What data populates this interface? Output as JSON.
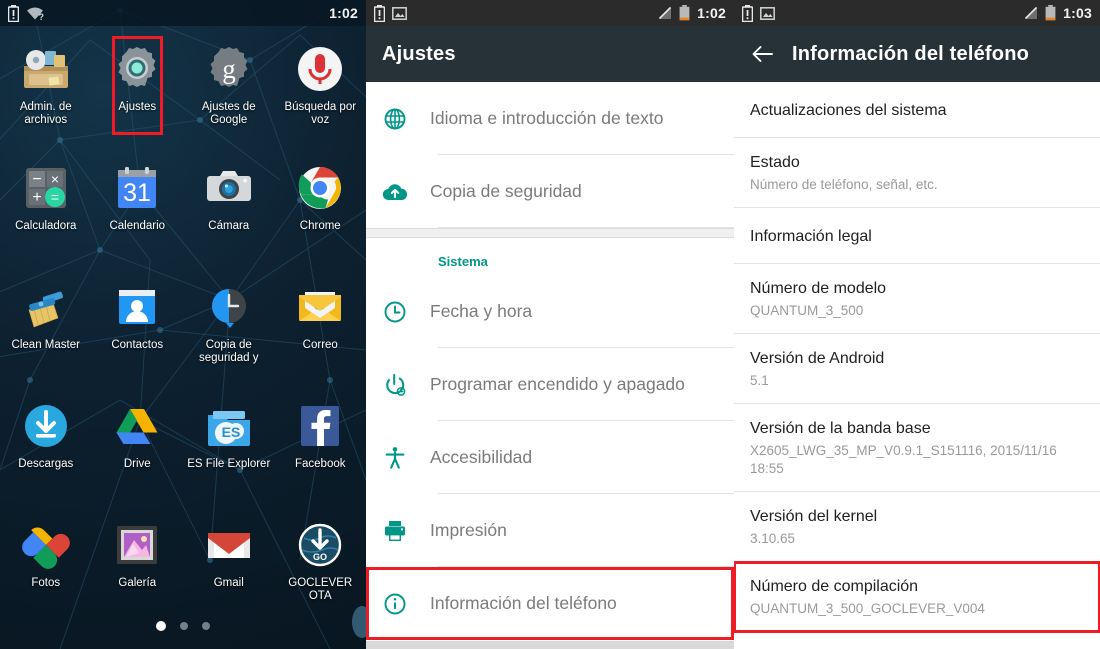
{
  "panels": {
    "home": {
      "statusbar": {
        "time": "1:02",
        "icons_left": [
          "battery-alert-icon",
          "wifi-question-icon"
        ]
      },
      "apps": [
        {
          "label": "Admin. de archivos",
          "icon": "file-manager-icon",
          "highlight": false
        },
        {
          "label": "Ajustes",
          "icon": "settings-gear-icon",
          "highlight": true
        },
        {
          "label": "Ajustes de Google",
          "icon": "google-settings-icon",
          "highlight": false
        },
        {
          "label": "Búsqueda por voz",
          "icon": "voice-search-microphone-icon",
          "highlight": false
        },
        {
          "label": "Calculadora",
          "icon": "calculator-icon",
          "highlight": false
        },
        {
          "label": "Calendario",
          "icon": "calendar-icon",
          "highlight": false
        },
        {
          "label": "Cámara",
          "icon": "camera-icon",
          "highlight": false
        },
        {
          "label": "Chrome",
          "icon": "chrome-icon",
          "highlight": false
        },
        {
          "label": "Clean Master",
          "icon": "clean-master-broom-icon",
          "highlight": false
        },
        {
          "label": "Contactos",
          "icon": "contacts-icon",
          "highlight": false
        },
        {
          "label": "Copia de seguridad y",
          "icon": "backup-clock-icon",
          "highlight": false
        },
        {
          "label": "Correo",
          "icon": "email-icon",
          "highlight": false
        },
        {
          "label": "Descargas",
          "icon": "downloads-icon",
          "highlight": false
        },
        {
          "label": "Drive",
          "icon": "google-drive-icon",
          "highlight": false
        },
        {
          "label": "ES File Explorer",
          "icon": "es-file-explorer-icon",
          "highlight": false
        },
        {
          "label": "Facebook",
          "icon": "facebook-icon",
          "highlight": false
        },
        {
          "label": "Fotos",
          "icon": "google-photos-icon",
          "highlight": false
        },
        {
          "label": "Galería",
          "icon": "gallery-icon",
          "highlight": false
        },
        {
          "label": "Gmail",
          "icon": "gmail-icon",
          "highlight": false
        },
        {
          "label": "GOCLEVER OTA",
          "icon": "goclever-ota-icon",
          "highlight": false
        }
      ],
      "page_dots": {
        "count": 3,
        "active_index": 0
      }
    },
    "settings": {
      "statusbar": {
        "time": "1:02",
        "icons_left": [
          "battery-alert-icon",
          "screenshot-image-icon"
        ]
      },
      "title": "Ajustes",
      "items_top": [
        {
          "label": "Idioma e introducción de texto",
          "icon": "globe-icon"
        },
        {
          "label": "Copia de seguridad",
          "icon": "cloud-upload-icon"
        }
      ],
      "section_label": "Sistema",
      "items_system": [
        {
          "label": "Fecha y hora",
          "icon": "clock-icon",
          "highlight": false
        },
        {
          "label": "Programar encendido y apagado",
          "icon": "power-schedule-icon",
          "highlight": false
        },
        {
          "label": "Accesibilidad",
          "icon": "accessibility-icon",
          "highlight": false
        },
        {
          "label": "Impresión",
          "icon": "printer-icon",
          "highlight": false
        },
        {
          "label": "Información del teléfono",
          "icon": "info-circle-icon",
          "highlight": true
        }
      ]
    },
    "about": {
      "statusbar": {
        "time": "1:03",
        "icons_left": [
          "battery-alert-icon",
          "screenshot-image-icon"
        ]
      },
      "title": "Información del teléfono",
      "back_icon": "back-arrow-icon",
      "items": [
        {
          "title": "Actualizaciones del sistema",
          "sub": "",
          "highlight": false
        },
        {
          "title": "Estado",
          "sub": "Número de teléfono, señal, etc.",
          "highlight": false
        },
        {
          "title": "Información legal",
          "sub": "",
          "highlight": false
        },
        {
          "title": "Número de modelo",
          "sub": "QUANTUM_3_500",
          "highlight": false
        },
        {
          "title": "Versión de Android",
          "sub": "5.1",
          "highlight": false
        },
        {
          "title": "Versión de la banda base",
          "sub": "X2605_LWG_35_MP_V0.9.1_S151116, 2015/11/16 18:55",
          "highlight": false
        },
        {
          "title": "Versión del kernel",
          "sub": "3.10.65",
          "highlight": false
        },
        {
          "title": "Número de compilación",
          "sub": "QUANTUM_3_500_GOCLEVER_V004",
          "highlight": true
        }
      ]
    }
  },
  "colors": {
    "appbar": "#263238",
    "accent_teal": "#009688",
    "highlight_red": "#ee1c24",
    "statusbar": "#2b2b2b",
    "wallpaper": "#0b1d2b"
  }
}
